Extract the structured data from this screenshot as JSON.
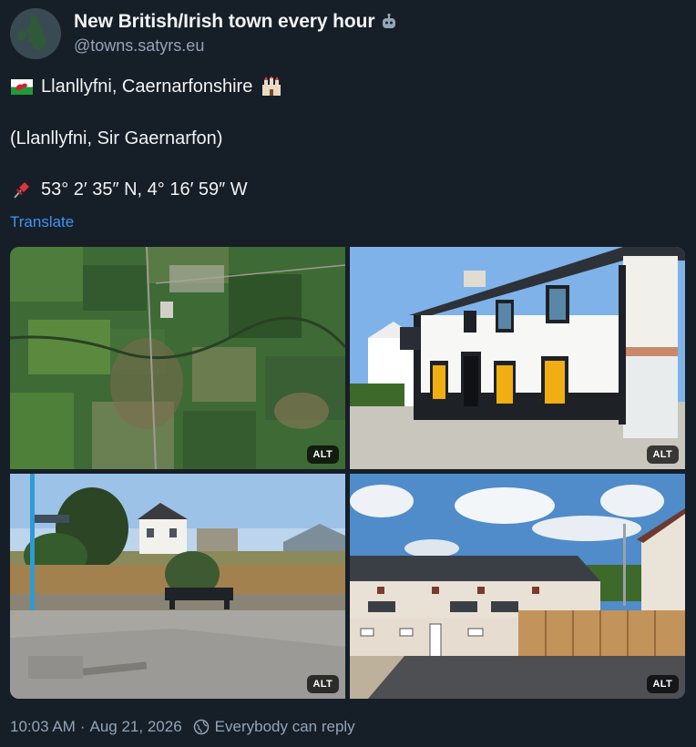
{
  "author": {
    "display_name": "New British/Irish town every hour",
    "handle": "@towns.satyrs.eu",
    "avatar_icon": "map-avatar-icon",
    "bot_icon": "bot-icon"
  },
  "post": {
    "line1_flag": "wales-flag-emoji",
    "line1_text": "Llanllyfni, Caernarfonshire",
    "line1_castle": "castle-emoji",
    "line2_text": "(Llanllyfni, Sir Gaernarfon)",
    "line3_pin": "pushpin-emoji",
    "line3_text": "53° 2′ 35″ N, 4° 16′ 59″ W"
  },
  "translate_label": "Translate",
  "images": [
    {
      "alt_label": "ALT"
    },
    {
      "alt_label": "ALT"
    },
    {
      "alt_label": "ALT"
    },
    {
      "alt_label": "ALT"
    }
  ],
  "footer": {
    "time": "10:03 AM",
    "separator": "·",
    "date": "Aug 21, 2026",
    "reply_icon": "globe-icon",
    "reply_setting": "Everybody can reply"
  },
  "colors": {
    "background": "#161e27",
    "text": "#f1f3f5",
    "muted": "#93a5b7",
    "link": "#3f94f5"
  }
}
